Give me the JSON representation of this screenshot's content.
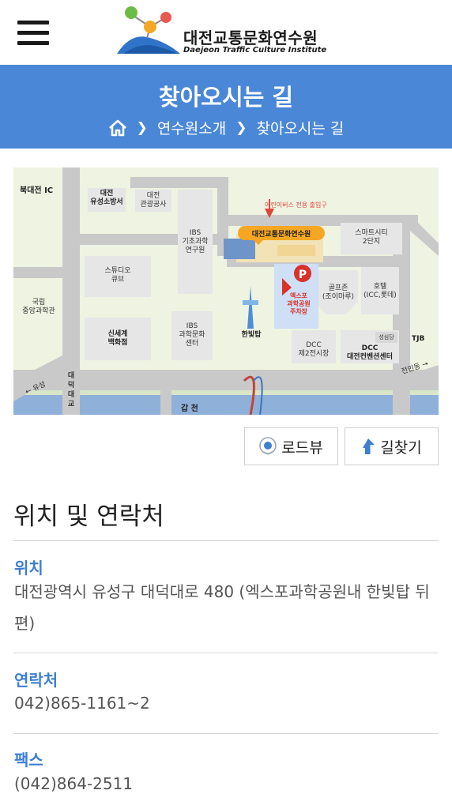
{
  "header": {
    "logo_ko": "대전교통문화연수원",
    "logo_en": "Daejeon Traffic Culture Institute"
  },
  "banner": {
    "title": "찾아오시는 길",
    "breadcrumb": [
      "연수원소개",
      "찾아오시는 길"
    ]
  },
  "map": {
    "labels": {
      "bukdaejeon_ic": "북대전 IC",
      "fire": "대전\n유성소방서",
      "tourism": "대전\n관광공사",
      "ibs_basic": "IBS\n기초과학\n연구원",
      "bus_entrance": "어린이버스 전용 출입구",
      "institute": "대전교통문화연수원",
      "smartcity": "스마트시티\n2단지",
      "studio": "스튜디오\n큐브",
      "national_museum": "국립\n중앙과학관",
      "shinsegae": "신세계\n백화점",
      "ibs_culture": "IBS\n과학문화\n센터",
      "hanbit": "한빛탑",
      "expo_parking": "엑스포\n과학공원\n주차장",
      "golfzon": "골프존\n(조이마루)",
      "hotel": "호텔\n(ICC,롯데)",
      "dcc2": "DCC\n제2전시장",
      "dcc": "DCC\n대전컨벤션센터",
      "seongsimdang": "성심당",
      "tjb": "TJB",
      "daedeok_bridge": "대\n덕\n대\n교",
      "yuseong": "← 유성",
      "gapcheon": "갑 천",
      "jeonmin": "전민동 →"
    }
  },
  "buttons": {
    "roadview": "로드뷰",
    "route": "길찾기"
  },
  "info": {
    "title": "위치 및 연락처",
    "location_label": "위치",
    "location_value": "대전광역시 유성구 대덕대로 480 (엑스포과학공원내 한빛탑 뒤편)",
    "contact_label": "연락처",
    "contact_value": "042)865-1161~2",
    "fax_label": "팩스",
    "fax_value": "(042)864-2511"
  },
  "colors": {
    "accent": "#4a87d6",
    "label_blue": "#3f7fd0",
    "map_bg": "#eef3e2",
    "map_road": "#c9c9c9",
    "river": "#8fb0d9"
  }
}
